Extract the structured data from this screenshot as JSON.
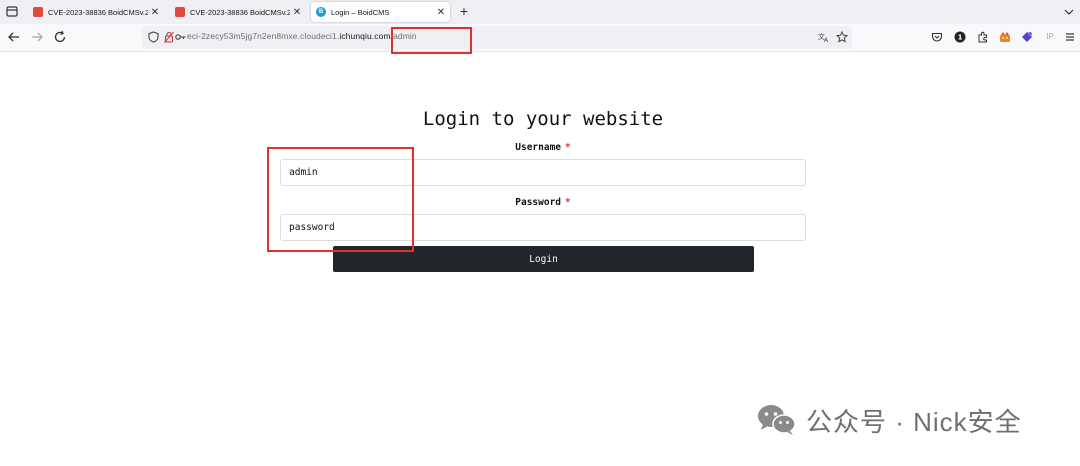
{
  "browser": {
    "tabs": [
      {
        "title": "CVE-2023-38836 BoidCMSv.2.0",
        "active": false
      },
      {
        "title": "CVE-2023-38836 BoidCMSv.2.0",
        "active": false
      },
      {
        "title": "Login – BoidCMS",
        "active": true
      }
    ],
    "new_tab": "+",
    "close_glyph": "✕",
    "favicon_b": "B",
    "url": {
      "prefix": "eci-2zecy53m5jg7n2en8mxe.cloudeci1.",
      "domain": "ichunqiu.com",
      "path": "/admin"
    },
    "toolbar_icons": [
      "back-icon",
      "forward-icon",
      "reload-icon",
      "shield-icon",
      "lock-icon",
      "key-icon",
      "translate-icon",
      "star-icon",
      "pocket-icon",
      "account-icon",
      "extensions-icon",
      "fox-icon",
      "ext-puzzle-icon",
      "ip-icon",
      "menu-icon"
    ],
    "ip_label": "IP"
  },
  "page": {
    "title": "Login to your website",
    "username_label": "Username",
    "username_value": "admin",
    "password_label": "Password",
    "password_value": "password",
    "required_mark": "*",
    "login_label": "Login"
  },
  "watermark": {
    "text": "公众号 · Nick安全"
  },
  "colors": {
    "highlight": "#e0322a",
    "button_bg": "#22252a",
    "tab_favicon": "#e2483d"
  }
}
